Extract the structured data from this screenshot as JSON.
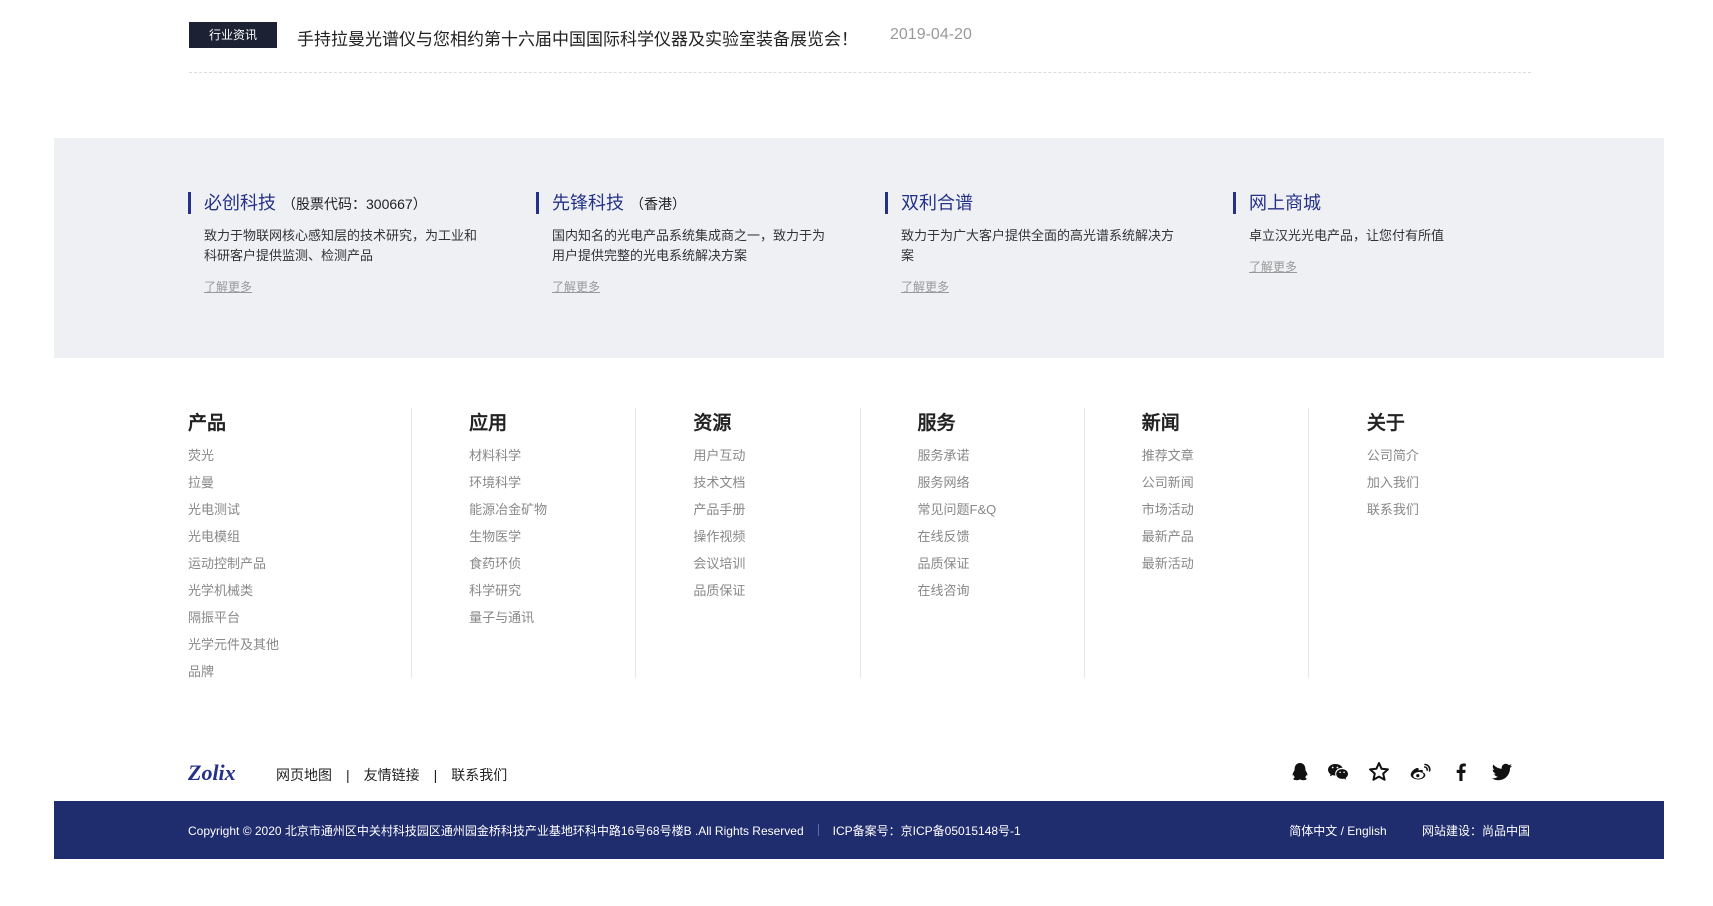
{
  "news": {
    "tag": "行业资讯",
    "title": "手持拉曼光谱仪与您相约第十六届中国国际科学仪器及实验室装备展览会！",
    "date": "2019-04-20"
  },
  "companies": [
    {
      "name": "必创科技",
      "sub": "（股票代码：300667）",
      "desc": "致力于物联网核心感知层的技术研究，为工业和科研客户提供监测、检测产品",
      "more": "了解更多"
    },
    {
      "name": "先锋科技",
      "sub": "（香港）",
      "desc": "国内知名的光电产品系统集成商之一，致力于为用户提供完整的光电系统解决方案",
      "more": "了解更多"
    },
    {
      "name": "双利合谱",
      "sub": "",
      "desc": "致力于为广大客户提供全面的高光谱系统解决方案",
      "more": "了解更多"
    },
    {
      "name": "网上商城",
      "sub": "",
      "desc": "卓立汉光光电产品，让您付有所值",
      "more": "了解更多"
    }
  ],
  "footer_nav": [
    {
      "title": "产品",
      "items": [
        "荧光",
        "拉曼",
        "光电测试",
        "光电模组",
        "运动控制产品",
        "光学机械类",
        "隔振平台",
        "光学元件及其他",
        "品牌"
      ]
    },
    {
      "title": "应用",
      "items": [
        "材料科学",
        "环境科学",
        "能源冶金矿物",
        "生物医学",
        "食药环侦",
        "科学研究",
        "量子与通讯"
      ]
    },
    {
      "title": "资源",
      "items": [
        "用户互动",
        "技术文档",
        "产品手册",
        "操作视频",
        "会议培训",
        "品质保证"
      ]
    },
    {
      "title": "服务",
      "items": [
        "服务承诺",
        "服务网络",
        "常见问题F&Q",
        "在线反馈",
        "品质保证",
        "在线咨询"
      ]
    },
    {
      "title": "新闻",
      "items": [
        "推荐文章",
        "公司新闻",
        "市场活动",
        "最新产品",
        "最新活动"
      ]
    },
    {
      "title": "关于",
      "items": [
        "公司简介",
        "加入我们",
        "联系我们"
      ]
    }
  ],
  "footer_links": {
    "logo_text": "Zolix",
    "links": [
      "网页地图",
      "友情链接",
      "联系我们"
    ],
    "separator": "|"
  },
  "social": [
    "qq-icon",
    "wechat-icon",
    "star-icon",
    "weibo-icon",
    "facebook-icon",
    "twitter-icon"
  ],
  "bottom_bar": {
    "copyright": "Copyright © 2020 北京市通州区中关村科技园区通州园金桥科技产业基地环科中路16号68号楼B .All Rights Reserved",
    "icp": "ICP备案号：京ICP备05015148号-1",
    "language": "简体中文 / English",
    "builder": "网站建设：尚品中国"
  },
  "colors": {
    "brand_blue": "#243187",
    "bar_bg": "#1f2c6e",
    "band_bg": "#eef0f4",
    "tag_bg": "#1c2233"
  }
}
